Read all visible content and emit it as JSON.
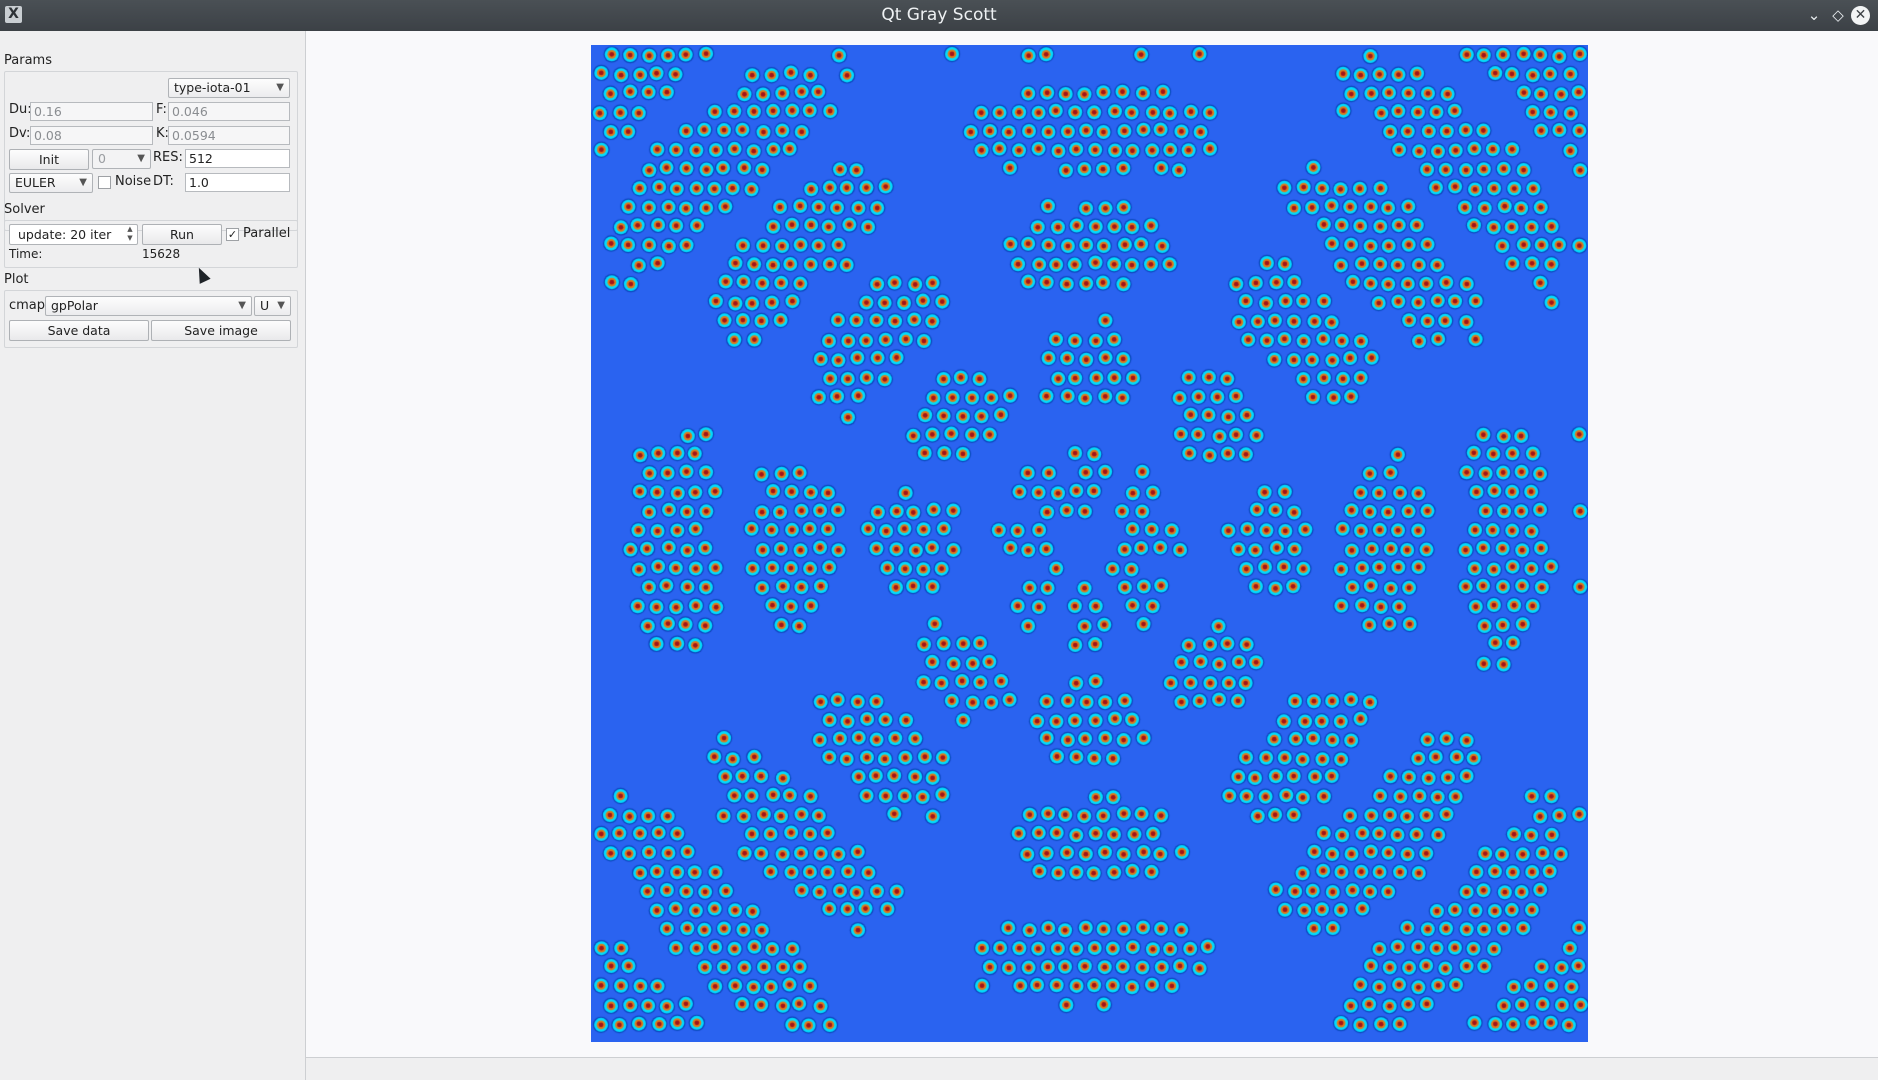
{
  "window": {
    "title": "Qt Gray Scott",
    "app_icon": "X"
  },
  "params": {
    "section_label": "Params",
    "preset": "type-iota-01",
    "du_label": "Du:",
    "du_value": "0.16",
    "f_label": "F:",
    "f_value": "0.046",
    "dv_label": "Dv:",
    "dv_value": "0.08",
    "k_label": "K:",
    "k_value": "0.0594",
    "init_button": "Init",
    "init_value": "0",
    "res_label": "RES:",
    "res_value": "512",
    "method": "EULER",
    "noise_label": "Noise",
    "noise_checked": false,
    "dt_label": "DT:",
    "dt_value": "1.0"
  },
  "solver": {
    "section_label": "Solver",
    "update_value": "update: 20 iter",
    "run_button": "Run",
    "parallel_label": "Parallel",
    "parallel_checked": true,
    "time_label": "Time:",
    "time_value": "15628"
  },
  "plot": {
    "section_label": "Plot",
    "cmap_label": "cmap:",
    "cmap_value": "gpPolar",
    "field_value": "U",
    "save_data_button": "Save data",
    "save_image_button": "Save image"
  },
  "colors": {
    "background_blue": "#2a63f0",
    "spot_ring": "#00dfff",
    "spot_core": "#e07a1a",
    "spot_center": "#a0141a"
  },
  "icons": {
    "minimize": "chevron-down-icon",
    "maximize": "diamond-icon",
    "close": "close-icon"
  }
}
